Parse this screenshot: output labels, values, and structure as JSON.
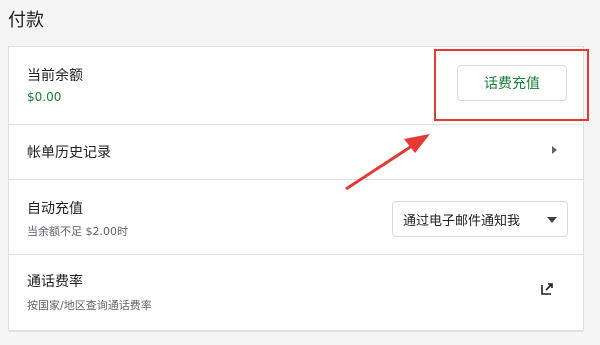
{
  "page": {
    "title": "付款"
  },
  "balance": {
    "label": "当前余额",
    "value": "$0.00",
    "button_label": "话费充值"
  },
  "history": {
    "label": "帐单历史记录"
  },
  "auto_topup": {
    "label": "自动充值",
    "sub": "当余额不足 $2.00时",
    "select_value": "通过电子邮件通知我"
  },
  "rates": {
    "label": "通话费率",
    "sub": "按国家/地区查询通话费率"
  },
  "icons": {
    "history_chevron": "chevron-right-icon",
    "select_caret": "caret-down-icon",
    "rates_link": "external-link-icon"
  },
  "colors": {
    "accent": "#188038",
    "annotation": "#e53935"
  }
}
